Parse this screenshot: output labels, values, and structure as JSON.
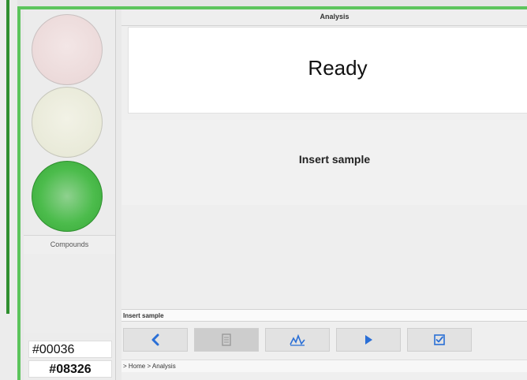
{
  "panel": {
    "title": "Analysis",
    "status_message": "Ready",
    "instruction": "Insert sample",
    "status_bar": "Insert sample",
    "breadcrumb": "> Home > Analysis"
  },
  "left": {
    "compounds_label": "Compounds",
    "codes": [
      "#00036",
      "#08326"
    ]
  },
  "indicators": {
    "red": "off",
    "yellow": "off",
    "green": "on"
  },
  "toolbar": {
    "icons": [
      "back-chevron-icon",
      "document-icon",
      "chart-icon",
      "play-icon",
      "checkbox-icon"
    ]
  },
  "colors": {
    "frame_accent": "#5cc45c",
    "icon_blue": "#2a6fd6",
    "indicator_green": "#4cbc4c"
  }
}
